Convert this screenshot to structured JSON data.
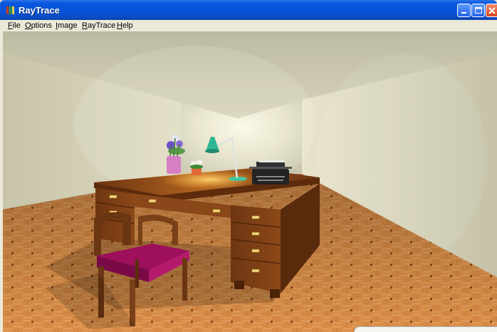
{
  "window": {
    "title": "RayTrace",
    "icon": "raytrace-app-icon",
    "controls": [
      "minimize-icon",
      "maximize-icon",
      "close-icon"
    ]
  },
  "menu": {
    "file": "File",
    "options": "Options",
    "image": "Image",
    "raytrace": "RayTrace",
    "help": "Help"
  },
  "scene": {
    "description_icon": "rendered-image",
    "colors": {
      "wall": "#e8e4cc",
      "floor": "#d9904a",
      "desk": "#7a3f16",
      "chair_seat": "#a0105f",
      "lamp": "#2fb894"
    }
  }
}
